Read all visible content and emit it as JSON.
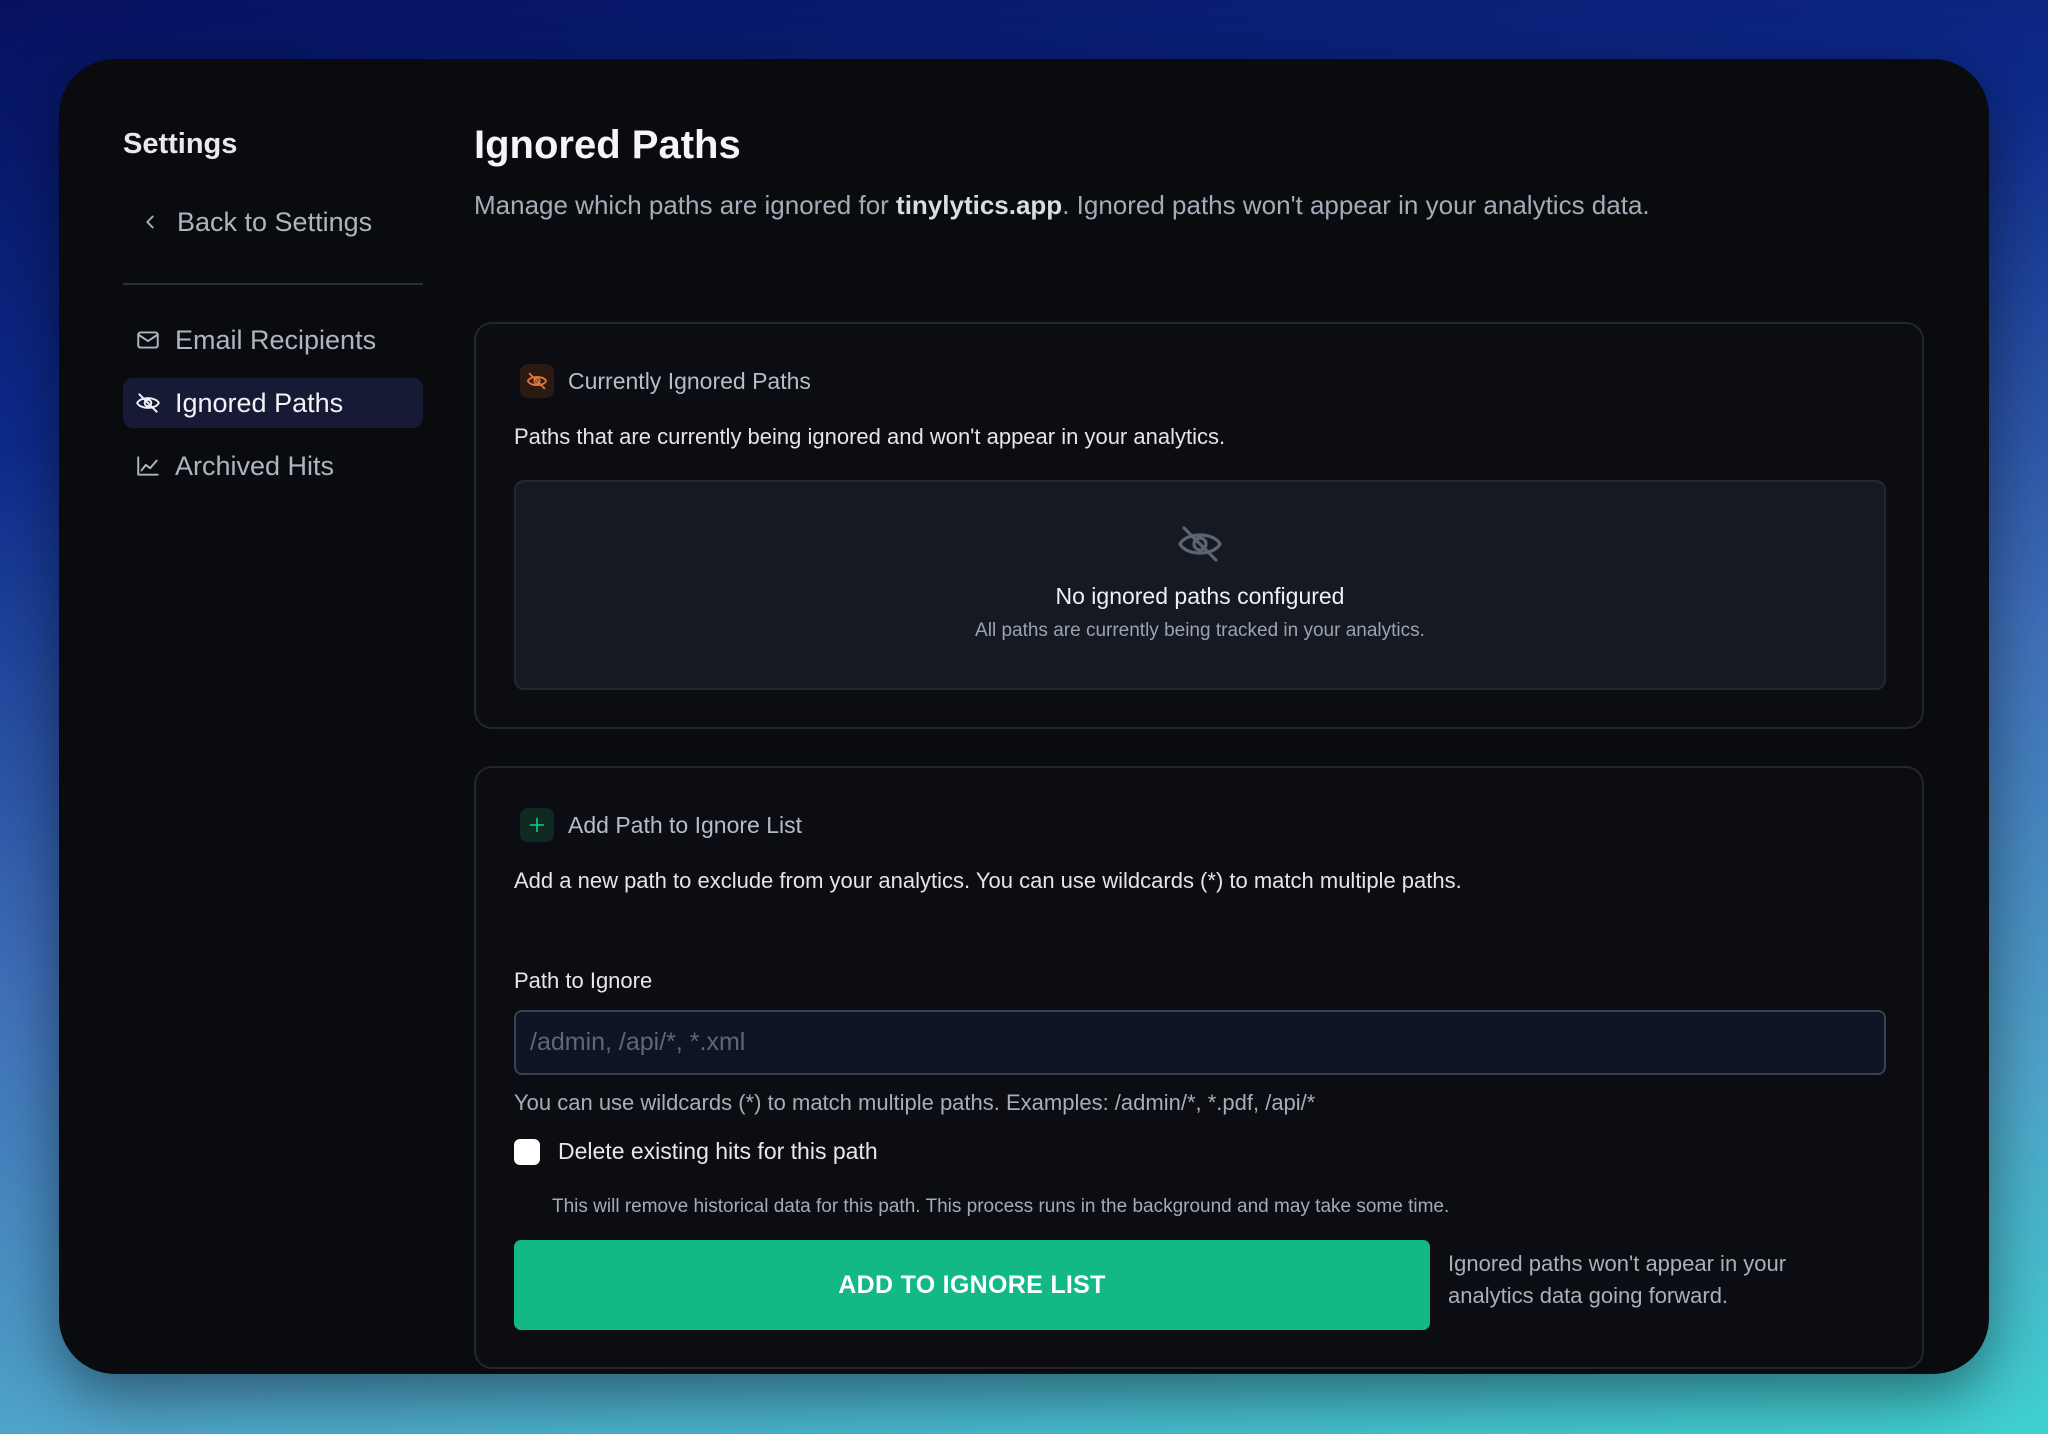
{
  "sidebar": {
    "title": "Settings",
    "back_label": "Back to Settings",
    "items": [
      {
        "label": "Email Recipients",
        "icon": "mail-icon",
        "active": false
      },
      {
        "label": "Ignored Paths",
        "icon": "eye-off-icon",
        "active": true
      },
      {
        "label": "Archived Hits",
        "icon": "chart-line-icon",
        "active": false
      }
    ]
  },
  "header": {
    "title": "Ignored Paths",
    "desc_prefix": "Manage which paths are ignored for ",
    "site": "tinylytics.app",
    "desc_suffix": ". Ignored paths won't appear in your analytics data."
  },
  "current_card": {
    "title": "Currently Ignored Paths",
    "description": "Paths that are currently being ignored and won't appear in your analytics.",
    "empty_title": "No ignored paths configured",
    "empty_subtitle": "All paths are currently being tracked in your analytics."
  },
  "add_card": {
    "title": "Add Path to Ignore List",
    "description": "Add a new path to exclude from your analytics. You can use wildcards (*) to match multiple paths.",
    "field_label": "Path to Ignore",
    "input_value": "",
    "input_placeholder": "/admin, /api/*, *.xml",
    "hint": "You can use wildcards (*) to match multiple paths. Examples: /admin/*, *.pdf, /api/*",
    "checkbox_label": "Delete existing hits for this path",
    "checkbox_checked": false,
    "checkbox_help": "This will remove historical data for this path. This process runs in the background and may take some time.",
    "button_label": "ADD TO IGNORE LIST",
    "side_note": "Ignored paths won't appear in your analytics data going forward."
  },
  "colors": {
    "accent": "#12b886",
    "active_nav": "#171a35",
    "warning_icon": "#e0743a",
    "background": "#0a0b0f"
  }
}
